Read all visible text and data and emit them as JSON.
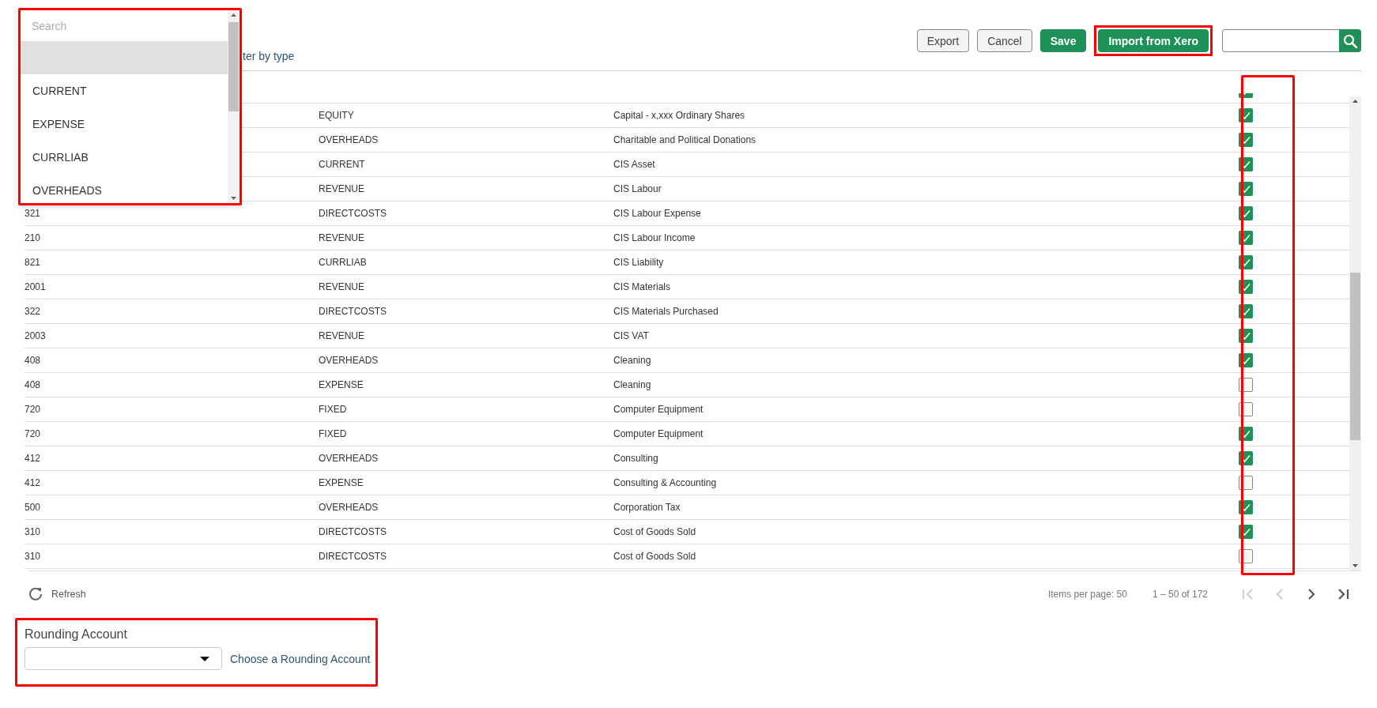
{
  "filter_link": {
    "text": "ter by type"
  },
  "toolbar": {
    "buttons": [
      {
        "label": "Export",
        "kind": "secondary",
        "highlighted": false
      },
      {
        "label": "Cancel",
        "kind": "secondary",
        "highlighted": false
      },
      {
        "label": "Save",
        "kind": "primary",
        "highlighted": false
      },
      {
        "label": "Import from Xero",
        "kind": "primary",
        "highlighted": true
      }
    ]
  },
  "type_dropdown": {
    "highlighted": true,
    "search": {
      "placeholder": "Search"
    },
    "options": [
      {
        "selected": true
      },
      {
        "label": "CURRENT",
        "selected": false
      },
      {
        "label": "EXPENSE",
        "selected": false
      },
      {
        "label": "CURRLIAB",
        "selected": false
      },
      {
        "label": "OVERHEADS",
        "selected": false
      }
    ]
  },
  "table": {
    "checkbox_column_highlighted": true,
    "rows": [
      {
        "checked": true
      },
      {
        "type": "EQUITY",
        "name": "Capital - x,xxx Ordinary Shares",
        "checked": true
      },
      {
        "type": "OVERHEADS",
        "name": "Charitable and Political Donations",
        "checked": true
      },
      {
        "type": "CURRENT",
        "name": "CIS Asset",
        "checked": true
      },
      {
        "type": "REVENUE",
        "name": "CIS Labour",
        "checked": true
      },
      {
        "code": "321",
        "type": "DIRECTCOSTS",
        "name": "CIS Labour Expense",
        "checked": true
      },
      {
        "code": "210",
        "type": "REVENUE",
        "name": "CIS Labour Income",
        "checked": true
      },
      {
        "code": "821",
        "type": "CURRLIAB",
        "name": "CIS Liability",
        "checked": true
      },
      {
        "code": "2001",
        "type": "REVENUE",
        "name": "CIS Materials",
        "checked": true
      },
      {
        "code": "322",
        "type": "DIRECTCOSTS",
        "name": "CIS Materials Purchased",
        "checked": true
      },
      {
        "code": "2003",
        "type": "REVENUE",
        "name": "CIS VAT",
        "checked": true
      },
      {
        "code": "408",
        "type": "OVERHEADS",
        "name": "Cleaning",
        "checked": true
      },
      {
        "code": "408",
        "type": "EXPENSE",
        "name": "Cleaning",
        "checked": false
      },
      {
        "code": "720",
        "type": "FIXED",
        "name": "Computer Equipment",
        "checked": false
      },
      {
        "code": "720",
        "type": "FIXED",
        "name": "Computer Equipment",
        "checked": true
      },
      {
        "code": "412",
        "type": "OVERHEADS",
        "name": "Consulting",
        "checked": true
      },
      {
        "code": "412",
        "type": "EXPENSE",
        "name": "Consulting & Accounting",
        "checked": false
      },
      {
        "code": "500",
        "type": "OVERHEADS",
        "name": "Corporation Tax",
        "checked": true
      },
      {
        "code": "310",
        "type": "DIRECTCOSTS",
        "name": "Cost of Goods Sold",
        "checked": true
      },
      {
        "code": "310",
        "type": "DIRECTCOSTS",
        "name": "Cost of Goods Sold",
        "checked": false
      }
    ]
  },
  "footer": {
    "refresh": "Refresh",
    "items_per_page": "Items per page: 50",
    "range": "1 – 50 of 172",
    "pager": [
      {
        "kind": "first",
        "disabled": true
      },
      {
        "kind": "previous",
        "disabled": true
      },
      {
        "kind": "next",
        "disabled": false
      },
      {
        "kind": "last",
        "disabled": false
      }
    ]
  },
  "rounding": {
    "highlighted": true,
    "label": "Rounding Account",
    "link": "Choose a Rounding Account"
  }
}
